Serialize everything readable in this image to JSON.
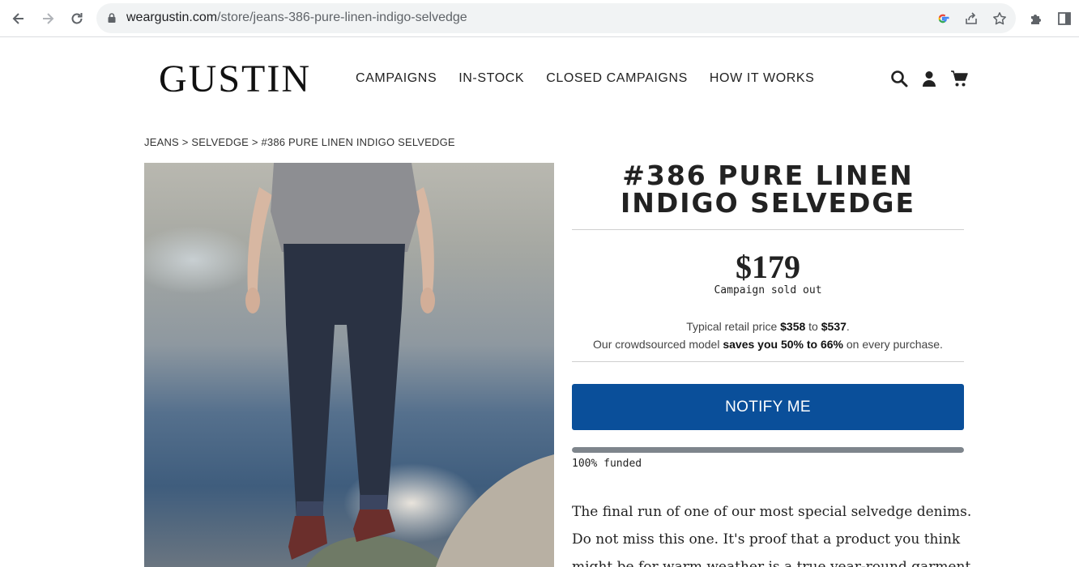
{
  "browser": {
    "url_host": "weargustin.com",
    "url_path": "/store/jeans-386-pure-linen-indigo-selvedge",
    "icons": [
      "back-icon",
      "forward-icon",
      "reload-icon",
      "lock-icon",
      "google-icon",
      "share-icon",
      "star-icon",
      "extensions-icon",
      "sidepanel-icon"
    ]
  },
  "site": {
    "logo": "GUSTIN",
    "nav": [
      "CAMPAIGNS",
      "IN-STOCK",
      "CLOSED CAMPAIGNS",
      "HOW IT WORKS"
    ],
    "header_icons": [
      "search-icon",
      "account-icon",
      "cart-icon"
    ]
  },
  "breadcrumb": {
    "jeans": "JEANS",
    "sep1": " > ",
    "selvedge": "SELVEDGE",
    "sep2": " > ",
    "current": "#386 PURE LINEN INDIGO SELVEDGE"
  },
  "product": {
    "title": "#386 PURE LINEN INDIGO SELVEDGE",
    "price": "$179",
    "status": "Campaign sold out",
    "retail_prefix": "Typical retail price ",
    "retail_low": "$358",
    "retail_mid": " to ",
    "retail_high": "$537",
    "retail_suffix": ".",
    "savings_prefix": "Our crowdsourced model ",
    "savings_bold": "saves you 50% to 66%",
    "savings_suffix": " on every purchase.",
    "cta": "NOTIFY ME",
    "funded_fraction": 1.0,
    "funded_text": "100% funded",
    "description": "The final run of one of our most special selvedge denims. Do not miss this one. It's proof that a product you think might be for warm weather is a true year-round garment."
  },
  "colors": {
    "cta": "#0a4f9a",
    "progress": "#7e858c"
  }
}
